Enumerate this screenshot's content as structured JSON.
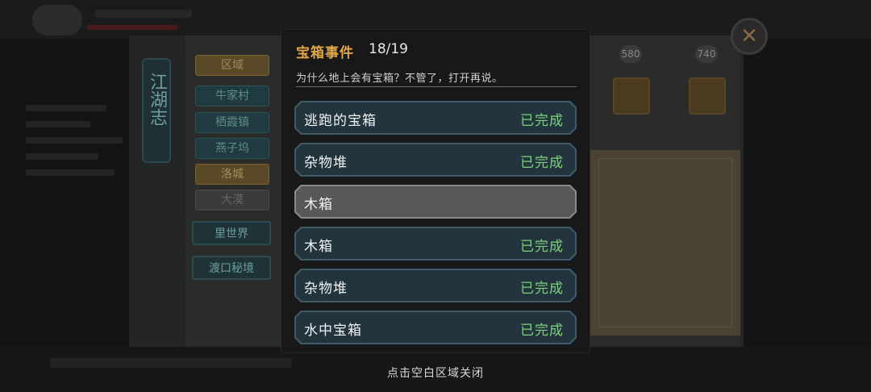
{
  "background": {
    "sidebar_title": "江湖志",
    "region_tabs": [
      "区域",
      "牛家村",
      "栖霞镇",
      "燕子坞",
      "洛城",
      "大漠"
    ],
    "world_buttons": [
      "里世界",
      "渡口秘境"
    ],
    "counters": [
      "580",
      "740"
    ]
  },
  "dialog": {
    "title": "宝箱事件",
    "progress": "18/19",
    "subtitle": "为什么地上会有宝箱？不管了，打开再说。",
    "events": [
      {
        "name": "逃跑的宝箱",
        "status": "已完成"
      },
      {
        "name": "杂物堆",
        "status": "已完成"
      },
      {
        "name": "木箱",
        "status": ""
      },
      {
        "name": "木箱",
        "status": "已完成"
      },
      {
        "name": "杂物堆",
        "status": "已完成"
      },
      {
        "name": "水中宝箱",
        "status": "已完成"
      }
    ]
  },
  "close_icon": "close-icon",
  "hint": "点击空白区域关闭",
  "colors": {
    "title_gold": "#e0a64a",
    "completed_green": "#7fd07a",
    "row_teal": "#22343d",
    "row_active": "#585858"
  }
}
